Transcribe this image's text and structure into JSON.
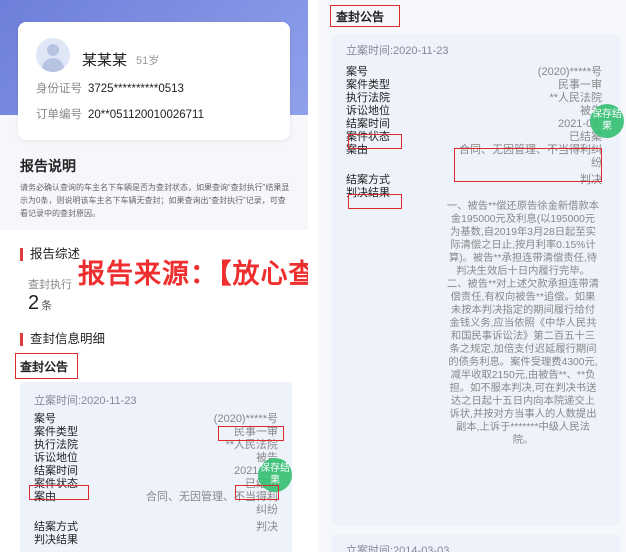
{
  "profile": {
    "name": "某某某",
    "age": "51岁",
    "id_label": "身份证号",
    "id_value": "3725**********0513",
    "order_label": "订单编号",
    "order_value": "20**051120010026711"
  },
  "report_desc": {
    "title": "报告说明",
    "text": "请务必确认查询的车主名下车辆是否为查封状态，如果查询“查封执行”结果显示为0条，则说明该车主名下车辆无查封；如果查询出“查封执行”记录，可查看记录中的查封原因。"
  },
  "summary": {
    "title": "报告综述",
    "count_label": "查封执行",
    "count_value": "2",
    "count_unit": "条"
  },
  "detail": {
    "title": "查封信息明细",
    "tab": "查封公告"
  },
  "watermark": "报告来源：【放心查车】公众号",
  "case1": {
    "date": "立案时间:2020-11-23",
    "fields": {
      "case_no_label": "案号",
      "case_no": "(2020)*****号",
      "type_label": "案件类型",
      "type": "民事一审",
      "court_label": "执行法院",
      "court": "**人民法院",
      "role_label": "诉讼地位",
      "role": "被告",
      "close_label": "结案时间",
      "close": "2021-02-",
      "status_label": "案件状态",
      "status": "已结案",
      "cause_label": "案由",
      "cause": "合同、无因管理、不当得利纠纷",
      "method_label": "结案方式",
      "method": "判决",
      "result_label": "判决结果",
      "result": "一、被告**偿还原告徐金新借款本金195000元及利息(以195000元为基数,自2019年3月28日起至实际清偿之日止,按月利率0.15%计算)。被告**承担连带清偿责任,待判决生效后十日内履行完毕。二、被告**对上述欠款承担连带清偿责任,有权向被告**追偿。如果未按本判决指定的期间履行给付金钱义务,应当依照《中华人民共和国民事诉讼法》第二百五十三条之规定,加倍支付迟延履行期间的债务利息。案件受理费4300元,减半收取2150元,由被告**、**负担。如不服本判决,可在判决书送达之日起十五日内向本院递交上诉状,并按对方当事人的人数提出副本,上诉于*******中级人民法院。"
    },
    "stamp": "保存结果"
  },
  "case2": {
    "date": "立案时间:2014-03-03"
  }
}
